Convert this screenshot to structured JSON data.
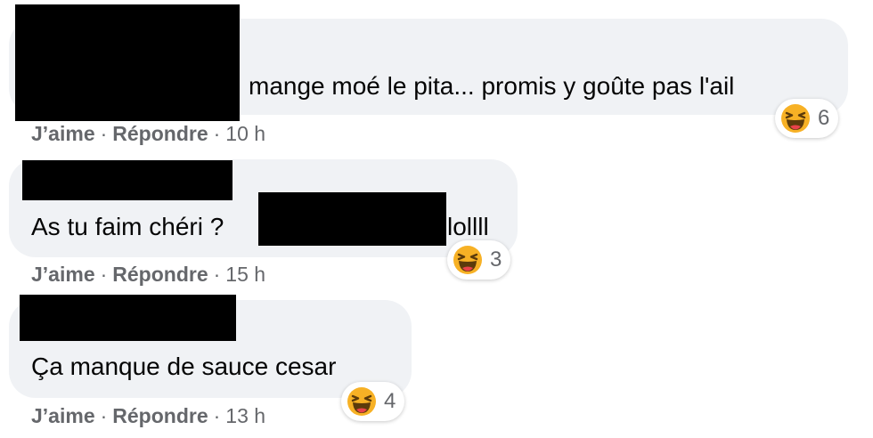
{
  "colors": {
    "bubble": "#f0f2f5",
    "text": "#050505",
    "meta": "#65676b",
    "redaction": "#000000",
    "haha_yellow": "#f7b125"
  },
  "comments": [
    {
      "text": "mange moé le pita... promis y goûte pas l'ail",
      "like_label": "J’aime",
      "reply_label": "Répondre",
      "separator": "·",
      "time": "10 h",
      "reaction": {
        "icon": "haha-icon",
        "count": "6"
      }
    },
    {
      "text": "As tu faim chéri ?",
      "text_tail": "lollll",
      "like_label": "J’aime",
      "reply_label": "Répondre",
      "separator": "·",
      "time": "15 h",
      "reaction": {
        "icon": "haha-icon",
        "count": "3"
      }
    },
    {
      "text": "Ça manque de sauce cesar",
      "like_label": "J’aime",
      "reply_label": "Répondre",
      "separator": "·",
      "time": "13 h",
      "reaction": {
        "icon": "haha-icon",
        "count": "4"
      }
    }
  ]
}
